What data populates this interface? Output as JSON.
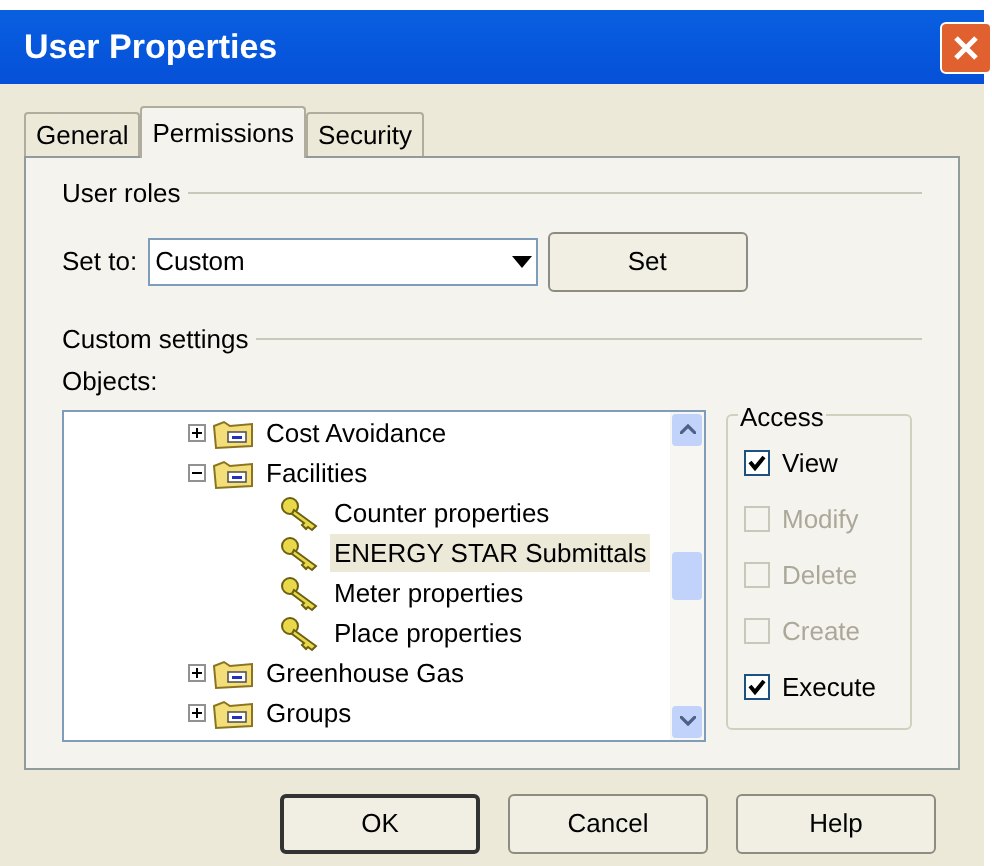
{
  "window": {
    "title": "User Properties"
  },
  "tabs": [
    {
      "label": "General",
      "selected": false
    },
    {
      "label": "Permissions",
      "selected": true
    },
    {
      "label": "Security",
      "selected": false
    }
  ],
  "user_roles": {
    "legend": "User roles",
    "set_to_label": "Set to:",
    "role": "Custom",
    "set_button": "Set"
  },
  "custom_settings": {
    "legend": "Custom settings",
    "objects_label": "Objects:",
    "tree": [
      {
        "label": "Cost Avoidance",
        "kind": "folder",
        "expanded": false,
        "selected": false
      },
      {
        "label": "Facilities",
        "kind": "folder",
        "expanded": true,
        "selected": false,
        "children": [
          {
            "label": "Counter properties",
            "kind": "key",
            "selected": false
          },
          {
            "label": "ENERGY STAR Submittals",
            "kind": "key",
            "selected": true
          },
          {
            "label": "Meter properties",
            "kind": "key",
            "selected": false
          },
          {
            "label": "Place properties",
            "kind": "key",
            "selected": false
          }
        ]
      },
      {
        "label": "Greenhouse Gas",
        "kind": "folder",
        "expanded": false,
        "selected": false
      },
      {
        "label": "Groups",
        "kind": "folder",
        "expanded": false,
        "selected": false
      }
    ],
    "access": {
      "legend": "Access",
      "options": [
        {
          "label": "View",
          "checked": true,
          "disabled": false
        },
        {
          "label": "Modify",
          "checked": false,
          "disabled": true
        },
        {
          "label": "Delete",
          "checked": false,
          "disabled": true
        },
        {
          "label": "Create",
          "checked": false,
          "disabled": true
        },
        {
          "label": "Execute",
          "checked": true,
          "disabled": false
        }
      ]
    }
  },
  "buttons": [
    "OK",
    "Cancel",
    "Help"
  ]
}
